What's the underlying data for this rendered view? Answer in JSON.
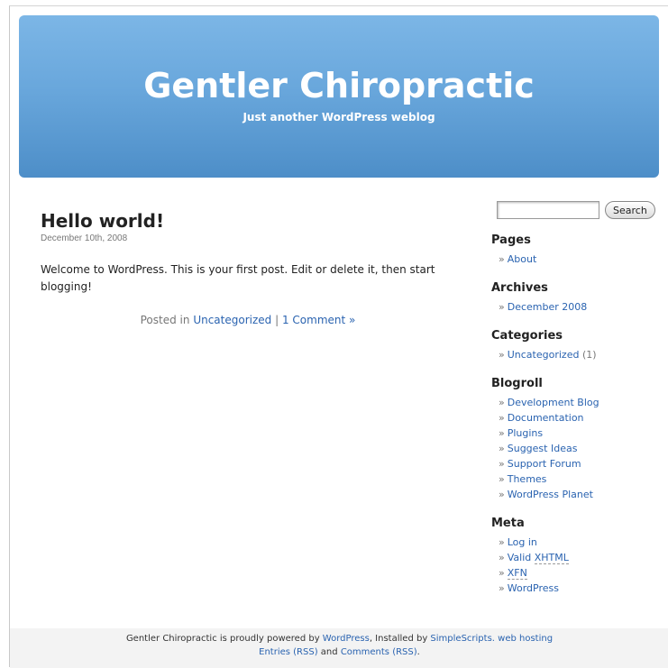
{
  "header": {
    "title": "Gentler Chiropractic",
    "description": "Just another WordPress weblog"
  },
  "post": {
    "title": "Hello world!",
    "date": "December 10th, 2008",
    "body": "Welcome to WordPress. This is your first post. Edit or delete it, then start blogging!",
    "meta_prefix": "Posted in",
    "category_link": "Uncategorized",
    "separator": "|",
    "comments_link": "1 Comment »"
  },
  "search": {
    "placeholder": "",
    "button_label": "Search"
  },
  "sidebar": {
    "pages": {
      "heading": "Pages",
      "items": [
        "About"
      ]
    },
    "archives": {
      "heading": "Archives",
      "items": [
        "December 2008"
      ]
    },
    "categories": {
      "heading": "Categories",
      "items": [
        {
          "label": "Uncategorized",
          "count": "(1)"
        }
      ]
    },
    "blogroll": {
      "heading": "Blogroll",
      "items": [
        "Development Blog",
        "Documentation",
        "Plugins",
        "Suggest Ideas",
        "Support Forum",
        "Themes",
        "WordPress Planet"
      ]
    },
    "meta": {
      "heading": "Meta",
      "log_in": "Log in",
      "valid_prefix": "Valid",
      "xhtml": "XHTML",
      "xfn": "XFN",
      "wordpress": "WordPress"
    },
    "bullet": "»"
  },
  "footer": {
    "text_before": "Gentler Chiropractic is proudly powered by",
    "wordpress_link": "WordPress",
    "installed_by": ", Installed by",
    "simplescripts_link": "SimpleScripts. web hosting",
    "entries_link": "Entries (RSS)",
    "and": "and",
    "comments_link": "Comments (RSS)",
    "period": "."
  },
  "colors": {
    "header_top": "#7cb6e6",
    "header_bottom": "#4d8ec8",
    "link": "#2a63b0"
  }
}
